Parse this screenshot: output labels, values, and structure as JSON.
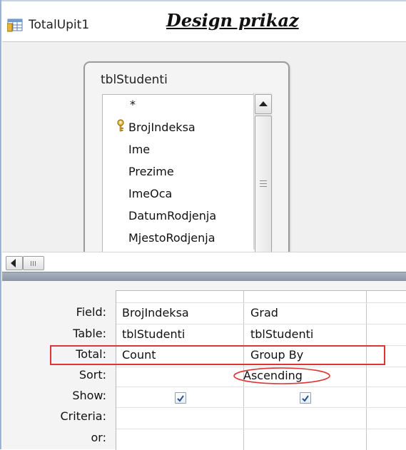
{
  "tab": {
    "title": "TotalUpit1",
    "icon": "query-icon"
  },
  "heading": "Design prikaz",
  "table_box": {
    "name": "tblStudenti",
    "fields": [
      "*",
      "BrojIndeksa",
      "Ime",
      "Prezime",
      "ImeOca",
      "DatumRodjenja",
      "MjestoRodjenja"
    ],
    "key_field": "BrojIndeksa"
  },
  "grid": {
    "row_labels": [
      "Field:",
      "Table:",
      "Total:",
      "Sort:",
      "Show:",
      "Criteria:",
      "or:"
    ],
    "columns": [
      {
        "field": "BrojIndeksa",
        "table": "tblStudenti",
        "total": "Count",
        "sort": "",
        "show": true
      },
      {
        "field": "Grad",
        "table": "tblStudenti",
        "total": "Group By",
        "sort": "Ascending",
        "show": true
      }
    ]
  },
  "colors": {
    "highlight": "#e03333",
    "splitter": "#8b95a4"
  }
}
